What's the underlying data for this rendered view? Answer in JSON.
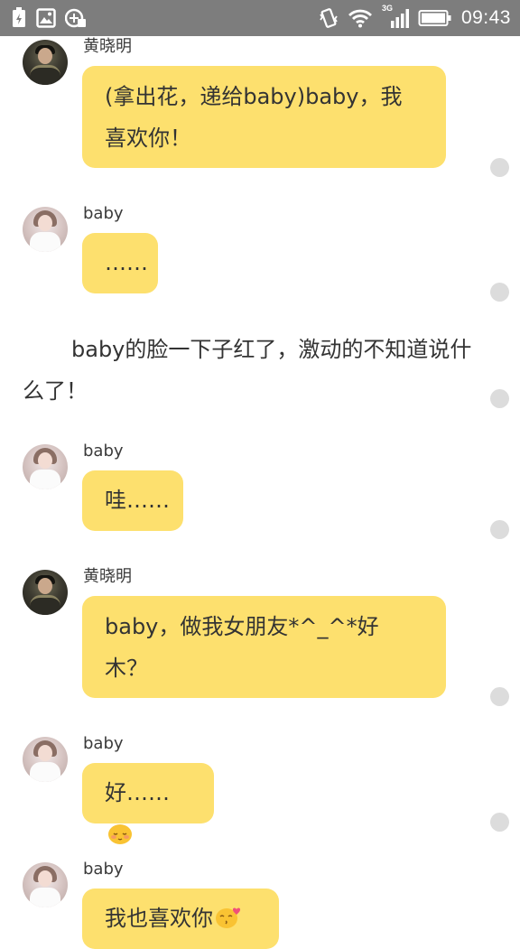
{
  "status_bar": {
    "time": "09:43",
    "network": "3G",
    "icons": [
      "battery-saver-icon",
      "image-icon",
      "data-icon",
      "vibrate-icon",
      "wifi-icon",
      "signal-icon",
      "battery-icon"
    ]
  },
  "messages": [
    {
      "sender": "黄晓明",
      "text": "(拿出花，递给baby)baby，我",
      "text2": "喜欢你！"
    },
    {
      "sender": "baby",
      "text": "……"
    },
    {
      "type": "narration",
      "text": "baby的脸一下子红了，激动的不知道说什么了！"
    },
    {
      "sender": "baby",
      "text": "哇……"
    },
    {
      "sender": "黄晓明",
      "text": "baby，做我女朋友*^_^*好",
      "text2": "木？"
    },
    {
      "sender": "baby",
      "text": "好……",
      "emoji": "shy-face-emoji"
    },
    {
      "sender": "baby",
      "text": "我也喜欢你",
      "emoji": "kiss-face-emoji"
    }
  ],
  "colors": {
    "bubble": "#fde06e",
    "status_bar": "#7d7d7d",
    "dot": "#dcdcdc"
  }
}
